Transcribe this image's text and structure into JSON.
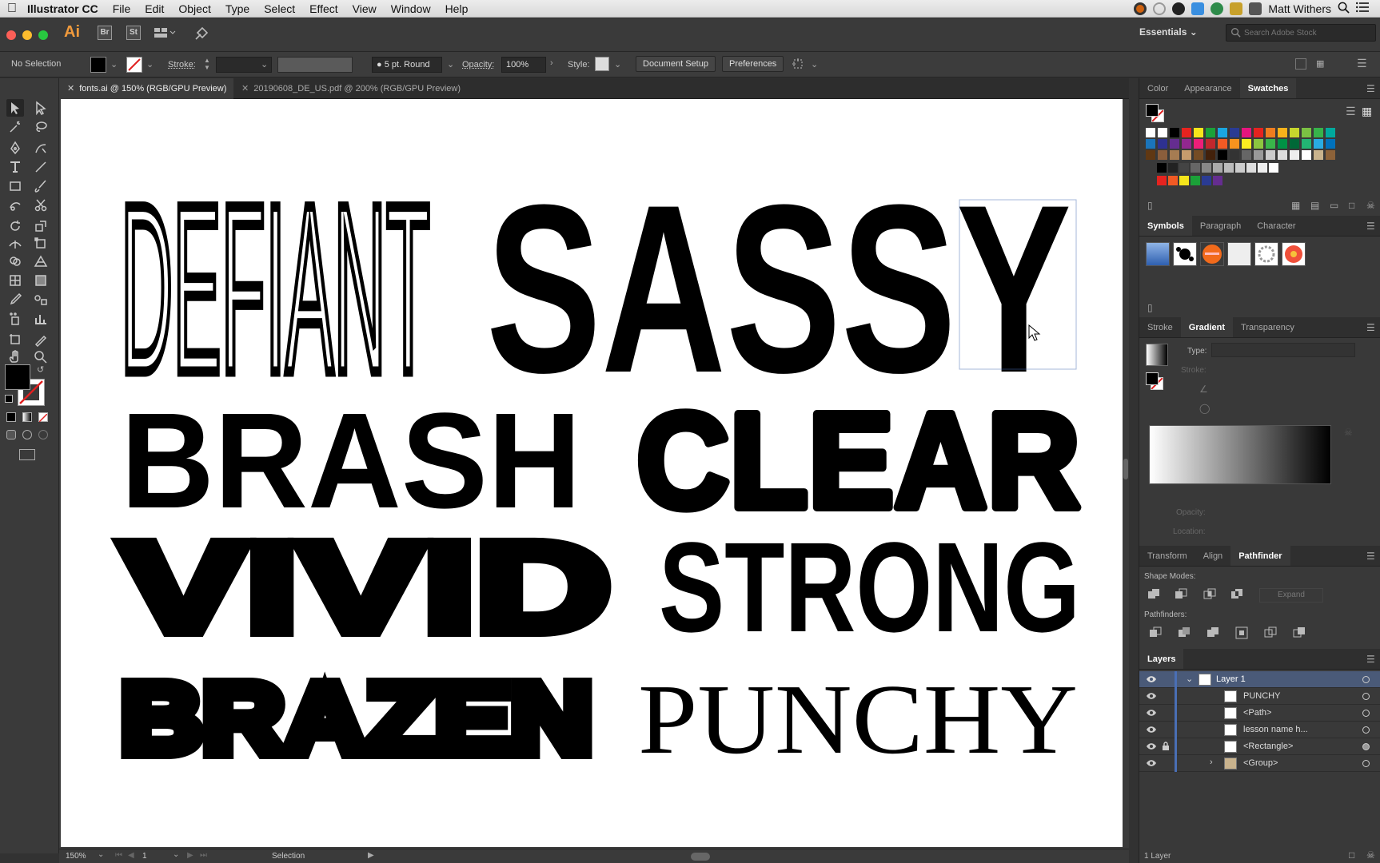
{
  "menubar": {
    "apple_icon": "apple-icon",
    "app_name": "Illustrator CC",
    "items": [
      "File",
      "Edit",
      "Object",
      "Type",
      "Select",
      "Effect",
      "View",
      "Window",
      "Help"
    ],
    "user_name": "Matt Withers"
  },
  "appbar": {
    "ai_logo": "Ai",
    "br": "Br",
    "st": "St",
    "workspace": "Essentials",
    "search_placeholder": "Search Adobe Stock"
  },
  "control_bar": {
    "selection_label": "No Selection",
    "stroke_label": "Stroke:",
    "brush_label": "5 pt. Round",
    "opacity_label": "Opacity:",
    "opacity_value": "100%",
    "style_label": "Style:",
    "doc_setup_button": "Document Setup",
    "preferences_button": "Preferences"
  },
  "doc_tabs": [
    {
      "label": "fonts.ai @ 150% (RGB/GPU Preview)",
      "active": true
    },
    {
      "label": "20190608_DE_US.pdf @ 200% (RGB/GPU Preview)",
      "active": false
    }
  ],
  "artwork_words": {
    "defiant": "DEFIANT",
    "sassy": "SASSY",
    "brash": "BRASH",
    "clear": "CLEAR",
    "vivid": "VIVID",
    "strong": "STRONG",
    "brazen": "BRAZEN",
    "punchy": "PUNCHY"
  },
  "status_bar": {
    "zoom": "150%",
    "artboard_number": "1",
    "tool_status": "Selection"
  },
  "panels": {
    "color_tabs": [
      "Color",
      "Appearance",
      "Swatches"
    ],
    "symbols_tabs": [
      "Symbols",
      "Paragraph",
      "Character"
    ],
    "gradient_tabs": [
      "Stroke",
      "Gradient",
      "Transparency"
    ],
    "gradient": {
      "type_label": "Type:",
      "stroke_label": "Stroke:",
      "opacity_label": "Opacity:",
      "location_label": "Location:"
    },
    "pathfinder_tabs": [
      "Transform",
      "Align",
      "Pathfinder"
    ],
    "pathfinder": {
      "shape_modes_label": "Shape Modes:",
      "expand_button": "Expand",
      "pathfinders_label": "Pathfinders:"
    },
    "layers": {
      "title": "Layers",
      "rows": [
        "Layer 1",
        "PUNCHY",
        "<Path>",
        "lesson name h...",
        "<Rectangle>",
        "<Group>"
      ],
      "footer": "1 Layer"
    }
  },
  "colors": {
    "accent_blue": "#4a6fb5",
    "app_bg": "#323232",
    "artboard": "#ffffff"
  }
}
